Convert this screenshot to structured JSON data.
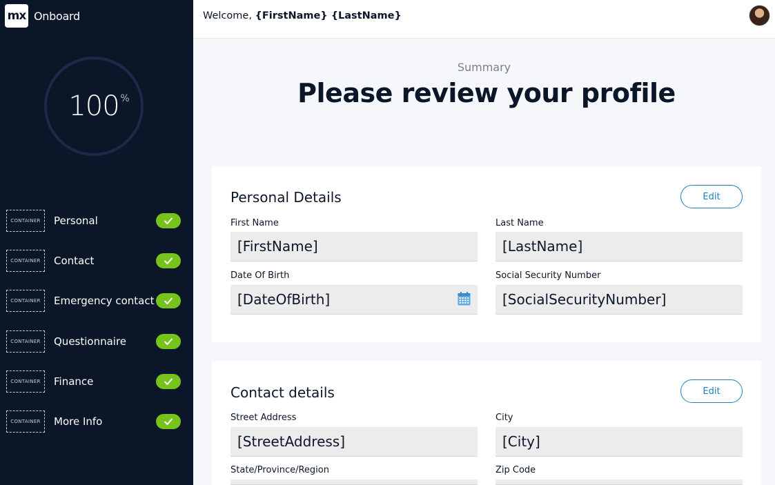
{
  "brand": {
    "logo_text": "mx",
    "name": "Onboard"
  },
  "progress": {
    "value": "100",
    "unit": "%"
  },
  "steps": [
    {
      "container": "CONTAINER",
      "label": "Personal",
      "complete": true
    },
    {
      "container": "CONTAINER",
      "label": "Contact",
      "complete": true
    },
    {
      "container": "CONTAINER",
      "label": "Emergency contact",
      "complete": true
    },
    {
      "container": "CONTAINER",
      "label": "Questionnaire",
      "complete": true
    },
    {
      "container": "CONTAINER",
      "label": "Finance",
      "complete": true
    },
    {
      "container": "CONTAINER",
      "label": "More Info",
      "complete": true
    }
  ],
  "header": {
    "welcome_prefix": "Welcome, ",
    "user_name": "{FirstName} {LastName}"
  },
  "main": {
    "subtitle": "Summary",
    "title": "Please review your profile"
  },
  "personal": {
    "title": "Personal Details",
    "edit_label": "Edit",
    "fields": [
      {
        "label": "First Name",
        "value": "[FirstName]"
      },
      {
        "label": "Last Name",
        "value": "[LastName]"
      },
      {
        "label": "Date Of Birth",
        "value": "[DateOfBirth]"
      },
      {
        "label": "Social Security Number",
        "value": "[SocialSecurityNumber]"
      }
    ]
  },
  "contact": {
    "title": "Contact details",
    "edit_label": "Edit",
    "fields": [
      {
        "label": "Street Address",
        "value": "[StreetAddress]"
      },
      {
        "label": "City",
        "value": "[City]"
      },
      {
        "label": "State/Province/Region",
        "value": ""
      },
      {
        "label": "Zip Code",
        "value": ""
      }
    ]
  },
  "colors": {
    "sidebar": "#0b1628",
    "accent": "#1a7fc4",
    "success": "#76c41b"
  },
  "icons": {
    "check": "check-icon",
    "calendar": "calendar-icon"
  }
}
